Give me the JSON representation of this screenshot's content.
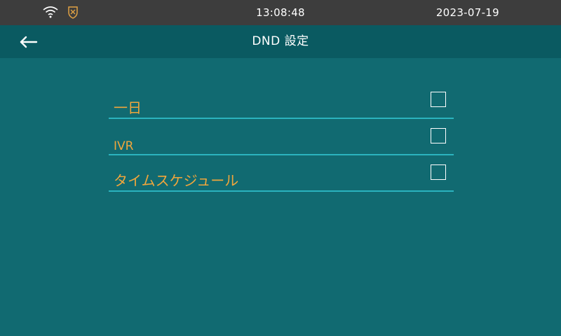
{
  "status_bar": {
    "time": "13:08:48",
    "date": "2023-07-19",
    "icons": [
      "wifi-icon",
      "shield-icon"
    ]
  },
  "header": {
    "title": "DND 設定",
    "back_icon": "arrow-left-icon"
  },
  "options": [
    {
      "label": "一日",
      "checked": false
    },
    {
      "label": "IVR",
      "checked": false
    },
    {
      "label": "タイムスケジュール",
      "checked": false
    }
  ],
  "colors": {
    "background": "#116a71",
    "header": "#0a5a61",
    "status_bar": "#3d3d3d",
    "label": "#f0a63c",
    "underline": "#2bb3be",
    "shield": "#e0a244"
  }
}
